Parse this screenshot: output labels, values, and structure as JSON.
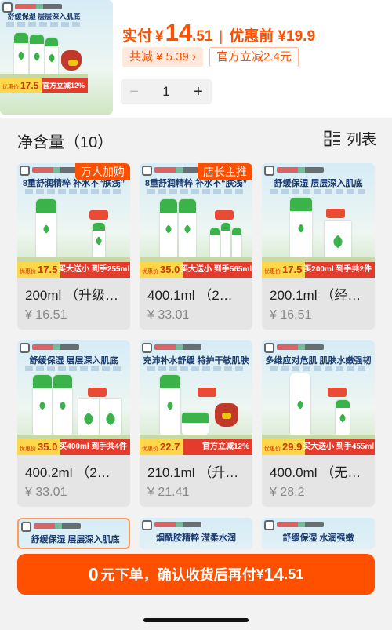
{
  "selected": {
    "price_label": "实付",
    "currency": "¥",
    "price_int": "14",
    "price_dec": ".51",
    "separator": "|",
    "before_label": "优惠前 ¥19.9",
    "discount_chip": "共减 ¥ 5.39 ›",
    "official_chip": "官方立减2.4元",
    "quantity": "1",
    "minus": "−",
    "plus": "+",
    "thumb": {
      "headline": "舒缓保湿 层层深入肌底",
      "promo_pre": "优惠价",
      "promo_value": "17.5",
      "promo_text": "官方立减12%"
    }
  },
  "section": {
    "title": "净含量（10）",
    "view_label": "列表"
  },
  "cards": [
    {
      "headline": "8重舒润精粹 补水不“肤浅”",
      "badge": "万人加购",
      "promo_pre": "优惠价",
      "promo_value": "17.5",
      "promo_text": "买大送小 到手255ml",
      "name": "200ml （升级…",
      "price": "¥ 16.51"
    },
    {
      "headline": "8重舒润精粹 补水不“肤浅”",
      "badge": "店长主推",
      "promo_pre": "优惠价",
      "promo_value": "35.0",
      "promo_text": "买大送小 到手565ml",
      "name": "400.1ml （2…",
      "price": "¥ 33.01"
    },
    {
      "headline": "舒缓保湿 层层深入肌底",
      "badge": "",
      "promo_pre": "优惠价",
      "promo_value": "17.5",
      "promo_text": "买200ml 到手共2件",
      "name": "200.1ml （经…",
      "price": "¥ 16.51"
    },
    {
      "headline": "舒缓保湿 层层深入肌底",
      "badge": "",
      "promo_pre": "优惠价",
      "promo_value": "35.0",
      "promo_text": "买400ml 到手共4件",
      "name": "400.2ml （2…",
      "price": "¥ 33.01"
    },
    {
      "headline": "充沛补水舒缓 特护干敏肌肤",
      "badge": "",
      "promo_pre": "优惠价",
      "promo_value": "22.7",
      "promo_text": "官方立减12%",
      "name": "210.1ml （升…",
      "price": "¥ 21.41"
    },
    {
      "headline": "多维应对危肌 肌肤水嫩强韧",
      "badge": "",
      "promo_pre": "优惠价",
      "promo_value": "29.9",
      "promo_text": "买大送小 到手455ml",
      "name": "400.0ml （无…",
      "price": "¥ 28.2"
    },
    {
      "headline": "舒缓保湿 层层深入肌底"
    },
    {
      "headline": "烟酰胺精粹 滢柔水润"
    },
    {
      "headline": "舒缓保湿 水润强嫩"
    }
  ],
  "cta": {
    "zero": "0",
    "text1": "元下单，确认收货后再付",
    "currency": "¥",
    "int": "14",
    "dec": ".51"
  },
  "colors": {
    "accent": "#ff5000",
    "promo_red": "#e53b2c",
    "promo_yellow": "#ffd84a",
    "leaf_green": "#3bb34a"
  },
  "icons": {
    "view_toggle": "grid-list-icon",
    "card_corner": "expand-square-icon"
  }
}
